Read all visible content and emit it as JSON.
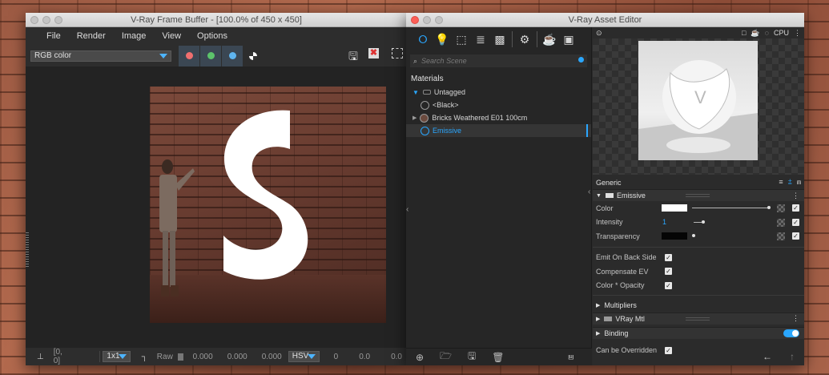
{
  "frame_buffer": {
    "title": "V-Ray Frame Buffer - [100.0% of 450 x 450]",
    "menu": [
      "File",
      "Render",
      "Image",
      "View",
      "Options"
    ],
    "channel_select": "RGB color",
    "channel_colors": {
      "red": "#ef6f6f",
      "green": "#5cc36b",
      "blue": "#5fb5ef"
    },
    "status": {
      "coords": "[0, 0]",
      "zoom": "1x1",
      "raw_label": "Raw",
      "raw_r": "0.000",
      "raw_g": "0.000",
      "raw_b": "0.000",
      "mode": "HSV",
      "h": "0",
      "s": "0.0",
      "v": "0.0"
    }
  },
  "asset_editor": {
    "title": "V-Ray Asset Editor",
    "search_placeholder": "Search Scene",
    "materials_header": "Materials",
    "group": "Untagged",
    "items": [
      "<Black>",
      "Bricks Weathered E01 100cm",
      "Emissive"
    ],
    "selected_item": "Emissive",
    "preview_toolbar": {
      "device": "CPU"
    },
    "generic_label": "Generic",
    "emissive_section": "Emissive",
    "params": {
      "color_label": "Color",
      "intensity_label": "Intensity",
      "intensity_value": "1",
      "transparency_label": "Transparency",
      "emit_back": "Emit On Back Side",
      "compensate": "Compensate EV",
      "color_opacity": "Color * Opacity"
    },
    "multipliers_label": "Multipliers",
    "vray_mtl_label": "VRay Mtl",
    "binding_label": "Binding",
    "can_override": "Can be Overridden",
    "accent": "#2aa7ff"
  }
}
